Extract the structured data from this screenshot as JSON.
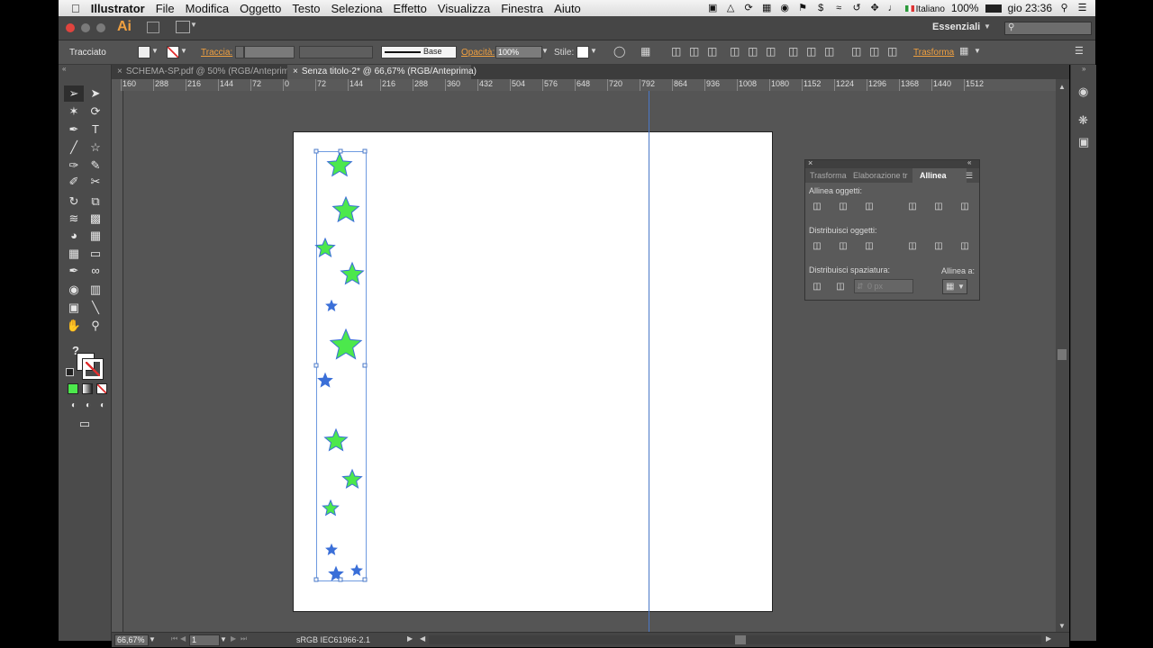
{
  "menubar": {
    "app_name": "Illustrator",
    "items": [
      "File",
      "Modifica",
      "Oggetto",
      "Testo",
      "Seleziona",
      "Effetto",
      "Visualizza",
      "Finestra",
      "Aiuto"
    ],
    "language": "Italiano",
    "battery": "100%",
    "clock": "gio 23:36"
  },
  "appbar": {
    "logo": "Ai",
    "workspace": "Essenziali"
  },
  "control_bar": {
    "selection_type": "Tracciato",
    "stroke_label": "Traccia:",
    "stroke_profile": "Base",
    "opacity_label": "Opacità:",
    "opacity_value": "100%",
    "style_label": "Stile:",
    "transform_link": "Trasforma"
  },
  "tabs": [
    {
      "label": "SCHEMA-SP.pdf @ 50% (RGB/Anteprima)",
      "active": false
    },
    {
      "label": "Senza titolo-2* @ 66,67% (RGB/Anteprima)",
      "active": true
    }
  ],
  "rulers": {
    "horizontal_ticks": [
      "160",
      "288",
      "216",
      "144",
      "72",
      "0",
      "72",
      "144",
      "216",
      "288",
      "360",
      "432",
      "504",
      "576",
      "648",
      "720",
      "792",
      "864",
      "936",
      "1008",
      "1080",
      "1152",
      "1224",
      "1296",
      "1368",
      "1440",
      "1512"
    ]
  },
  "align_panel": {
    "tabs": [
      "Trasforma",
      "Elaborazione tr",
      "Allinea"
    ],
    "active_tab": "Allinea",
    "section_align": "Allinea oggetti:",
    "section_distribute": "Distribuisci oggetti:",
    "section_spacing": "Distribuisci spaziatura:",
    "align_to_label": "Allinea a:",
    "spacing_value": "0 px"
  },
  "status_bar": {
    "zoom": "66,67%",
    "artboard_number": "1",
    "color_profile": "sRGB IEC61966-2.1"
  },
  "colors": {
    "star_fill": "#4ce84c",
    "star_outline": "#3a6fd8",
    "accent_orange": "#f0a040"
  }
}
